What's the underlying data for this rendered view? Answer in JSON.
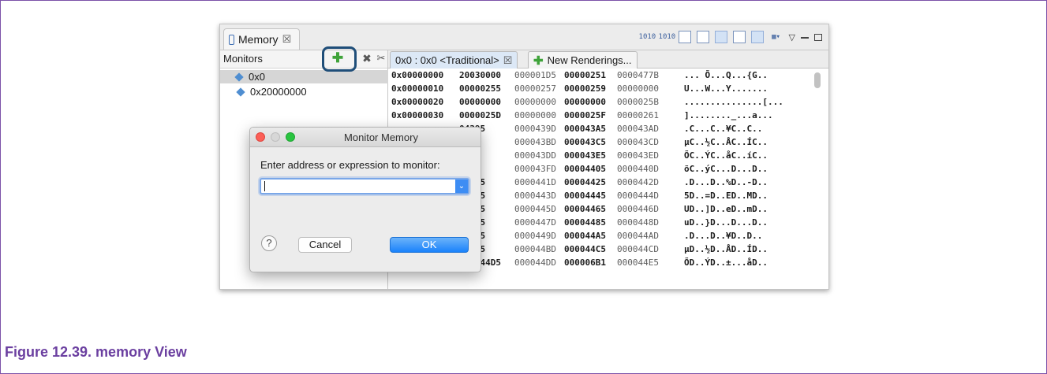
{
  "caption": "Figure 12.39. memory View",
  "view": {
    "tab_label": "Memory",
    "close_glyph": "☒",
    "toolbar_icons": [
      "binary-layout-icon",
      "swap-icon",
      "new-tab-icon",
      "export-icon",
      "link-icon",
      "columns-icon",
      "highlight-icon",
      "format-menu-icon",
      "view-menu-icon",
      "minimize-icon",
      "maximize-icon"
    ]
  },
  "monitors": {
    "title": "Monitors",
    "items": [
      {
        "label": "0x0",
        "selected": true
      },
      {
        "label": "0x20000000",
        "selected": false
      }
    ]
  },
  "renderings": {
    "active_tab": "0x0 : 0x0 <Traditional>",
    "new_tab": "New Renderings..."
  },
  "memory_rows": [
    {
      "addr": "0x00000000",
      "w0": "20030000",
      "w1": "000001D5",
      "w2": "00000251",
      "w3": "0000477B",
      "ascii": "... Õ...Q...{G.."
    },
    {
      "addr": "0x00000010",
      "w0": "00000255",
      "w1": "00000257",
      "w2": "00000259",
      "w3": "00000000",
      "ascii": "U...W...Y......."
    },
    {
      "addr": "0x00000020",
      "w0": "00000000",
      "w1": "00000000",
      "w2": "00000000",
      "w3": "0000025B",
      "ascii": "...............[..."
    },
    {
      "addr": "0x00000030",
      "w0": "0000025D",
      "w1": "00000000",
      "w2": "0000025F",
      "w3": "00000261",
      "ascii": "]........_...a..."
    },
    {
      "addr": "",
      "w0": "04395",
      "w1": "0000439D",
      "w2": "000043A5",
      "w3": "000043AD",
      "ascii": ".C...C..¥C..C.."
    },
    {
      "addr": "",
      "w0": "43B5",
      "w1": "000043BD",
      "w2": "000043C5",
      "w3": "000043CD",
      "ascii": "µC..½C..ÅC..ÍC.."
    },
    {
      "addr": "",
      "w0": "43D5",
      "w1": "000043DD",
      "w2": "000043E5",
      "w3": "000043ED",
      "ascii": "ÕC..ÝC..åC..íC.."
    },
    {
      "addr": "",
      "w0": "43F5",
      "w1": "000043FD",
      "w2": "00004405",
      "w3": "0000440D",
      "ascii": "õC..ýC...D...D.."
    },
    {
      "addr": "",
      "w0": "04415",
      "w1": "0000441D",
      "w2": "00004425",
      "w3": "0000442D",
      "ascii": ".D...D..%D..-D.."
    },
    {
      "addr": "",
      "w0": "04435",
      "w1": "0000443D",
      "w2": "00004445",
      "w3": "0000444D",
      "ascii": "5D..=D..ED..MD.."
    },
    {
      "addr": "",
      "w0": "04455",
      "w1": "0000445D",
      "w2": "00004465",
      "w3": "0000446D",
      "ascii": "UD..]D..eD..mD.."
    },
    {
      "addr": "",
      "w0": "04475",
      "w1": "0000447D",
      "w2": "00004485",
      "w3": "0000448D",
      "ascii": "uD..}D...D...D.."
    },
    {
      "addr": "",
      "w0": "04495",
      "w1": "0000449D",
      "w2": "000044A5",
      "w3": "000044AD",
      "ascii": ".D...D..¥D..D.."
    },
    {
      "addr": "",
      "w0": "044B5",
      "w1": "000044BD",
      "w2": "000044C5",
      "w3": "000044CD",
      "ascii": "µD..½D..ÅD..ÍD.."
    },
    {
      "addr": "0x000000E0",
      "w0": "000044D5",
      "w1": "000044DD",
      "w2": "000006B1",
      "w3": "000044E5",
      "ascii": "ÕD..ÝD..±...åD.."
    }
  ],
  "dialog": {
    "title": "Monitor Memory",
    "prompt": "Enter address or expression to monitor:",
    "input_value": "",
    "cancel_label": "Cancel",
    "ok_label": "OK",
    "help_label": "?"
  },
  "colors": {
    "frame_border": "#7b52a8",
    "caption": "#6b3fa0",
    "ok_button": "#1a82fb",
    "highlight_ring": "#1f4e79"
  }
}
